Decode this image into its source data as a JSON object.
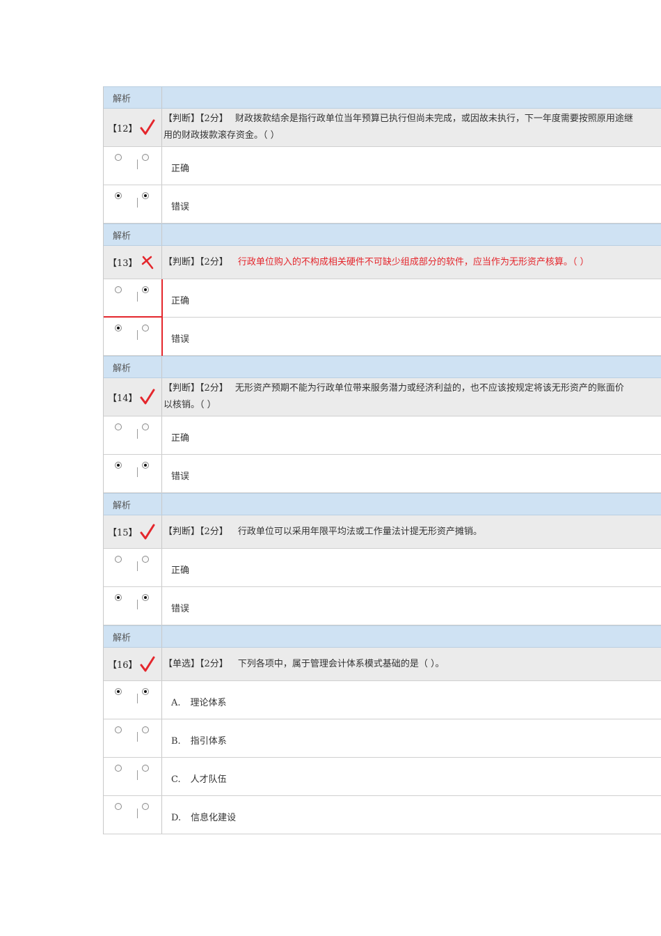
{
  "analysis_label": "解析",
  "colors": {
    "correct_mark": "#e4262c",
    "wrong_text": "#e4262c",
    "analysis_bg": "#cfe2f3"
  },
  "questions": [
    {
      "num": "【12】",
      "status": "correct",
      "type_tag": "【判断】【2分】",
      "stem_line1": "财政拨款结余是指行政单位当年预算已执行但尚未完成，或因故未执行，下一年度需要按照原用途继",
      "stem_line2": "用的财政拨款滚存资金。（ ）",
      "options": [
        {
          "letter": "",
          "text": "正确"
        },
        {
          "letter": "",
          "text": "错误"
        }
      ]
    },
    {
      "num": "【13】",
      "status": "wrong",
      "type_tag": "【判断】【2分】",
      "stem_line1": "行政单位购入的不构成相关硬件不可缺少组成部分的软件，应当作为无形资产核算。（ ）",
      "stem_line2": "",
      "options": [
        {
          "letter": "",
          "text": "正确"
        },
        {
          "letter": "",
          "text": "错误"
        }
      ]
    },
    {
      "num": "【14】",
      "status": "correct",
      "type_tag": "【判断】【2分】",
      "stem_line1": "无形资产预期不能为行政单位带来服务潜力或经济利益的，也不应该按规定将该无形资产的账面价",
      "stem_line2": "以核销。（ ）",
      "options": [
        {
          "letter": "",
          "text": "正确"
        },
        {
          "letter": "",
          "text": "错误"
        }
      ]
    },
    {
      "num": "【15】",
      "status": "correct",
      "type_tag": "【判断】【2分】",
      "stem_line1": "行政单位可以采用年限平均法或工作量法计提无形资产摊销。",
      "stem_line2": "",
      "options": [
        {
          "letter": "",
          "text": "正确"
        },
        {
          "letter": "",
          "text": "错误"
        }
      ]
    },
    {
      "num": "【16】",
      "status": "correct",
      "type_tag": "【单选】【2分】",
      "stem_line1": "下列各项中，属于管理会计体系模式基础的是（ ）。",
      "stem_line2": "",
      "options": [
        {
          "letter": "A.",
          "text": "理论体系"
        },
        {
          "letter": "B.",
          "text": "指引体系"
        },
        {
          "letter": "C.",
          "text": "人才队伍"
        },
        {
          "letter": "D.",
          "text": "信息化建设"
        }
      ]
    }
  ]
}
